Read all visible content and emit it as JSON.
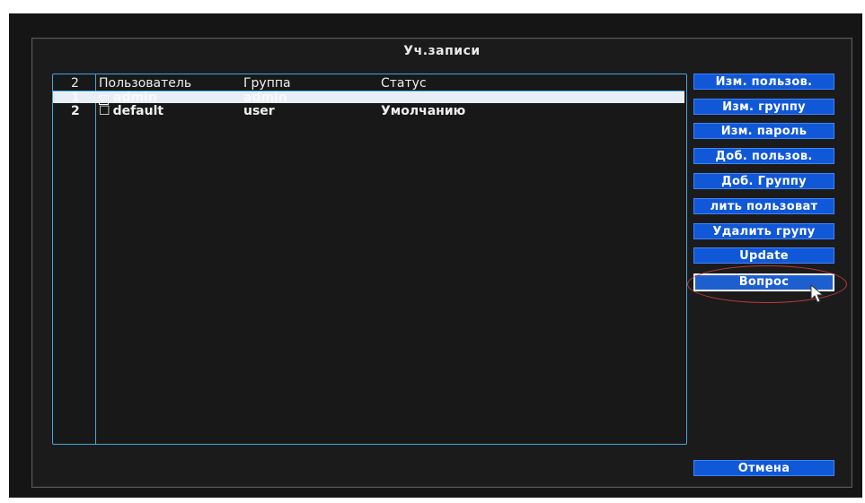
{
  "window": {
    "title": "Уч.записи"
  },
  "list": {
    "headers": {
      "count": "2",
      "user": "Пользователь",
      "group": "Группа",
      "status": "Статус"
    },
    "rows": [
      {
        "num": "1",
        "check": "☑",
        "user": "admin",
        "group": "admin",
        "status": "",
        "selected": true
      },
      {
        "num": "2",
        "check": "☐",
        "user": "default",
        "group": "user",
        "status": "Умолчанию",
        "selected": false
      }
    ]
  },
  "buttons": {
    "edit_user": "Изм. пользов.",
    "edit_group": "Изм. группу",
    "edit_password": "Изм. пароль",
    "add_user": "Доб. пользов.",
    "add_group": "Доб. Группу",
    "delete_user": "лить пользоват",
    "delete_group": "Удалить групу",
    "update": "Update",
    "question": "Вопрос",
    "cancel": "Отмена"
  },
  "colors": {
    "accent": "#1158d8",
    "frame": "#3fa7e3",
    "highlight": "#c23a3a"
  },
  "icons": {
    "cursor": "mouse-pointer-icon"
  }
}
